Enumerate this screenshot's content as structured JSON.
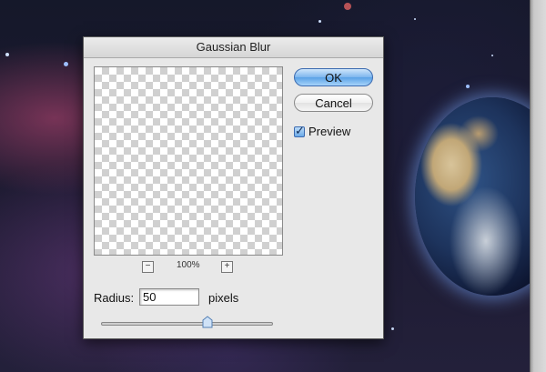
{
  "dialog": {
    "title": "Gaussian Blur",
    "ok_label": "OK",
    "cancel_label": "Cancel",
    "preview_label": "Preview",
    "preview_checked": true,
    "zoom_out_symbol": "−",
    "zoom_in_symbol": "+",
    "zoom_level": "100%",
    "radius_label": "Radius:",
    "radius_value": "50",
    "radius_units": "pixels",
    "slider_fraction": 0.62,
    "accent_color": "#5aa1e6"
  },
  "icons": {
    "checkmark": "check-icon"
  }
}
